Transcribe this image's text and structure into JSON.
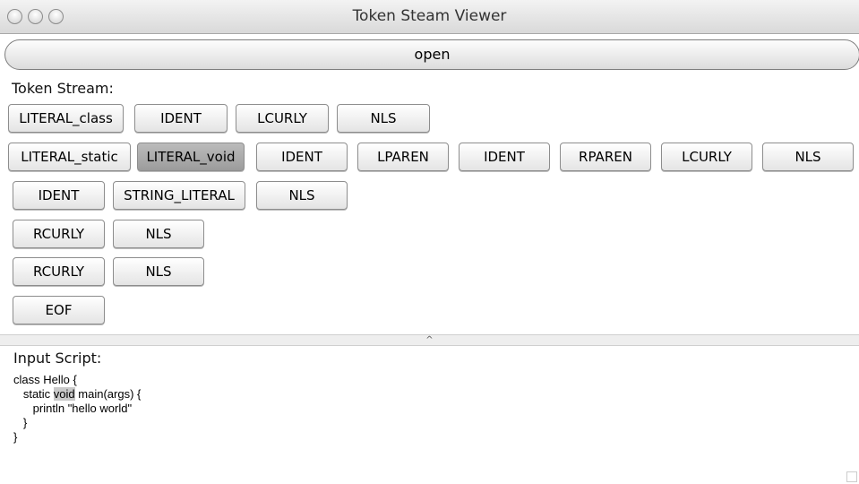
{
  "window": {
    "title": "Token Steam Viewer"
  },
  "toolbar": {
    "open_label": "open"
  },
  "token_stream": {
    "label": "Token Stream:",
    "rows": [
      [
        "LITERAL_class",
        "IDENT",
        "LCURLY",
        "NLS"
      ],
      [
        "LITERAL_static",
        "LITERAL_void",
        "IDENT",
        "LPAREN",
        "IDENT",
        "RPAREN",
        "LCURLY",
        "NLS"
      ],
      [
        "IDENT",
        "STRING_LITERAL",
        "NLS"
      ],
      [
        "RCURLY",
        "NLS"
      ],
      [
        "RCURLY",
        "NLS"
      ],
      [
        "EOF"
      ]
    ],
    "selected": "LITERAL_void"
  },
  "divider": {
    "glyph": "^"
  },
  "input_script": {
    "label": "Input Script:",
    "line1": "class Hello {",
    "line2_pre": "   static ",
    "line2_hl": "void",
    "line2_post": " main(args) {",
    "line3": "      println \"hello world\"",
    "line4": "   }",
    "line5": "}"
  }
}
